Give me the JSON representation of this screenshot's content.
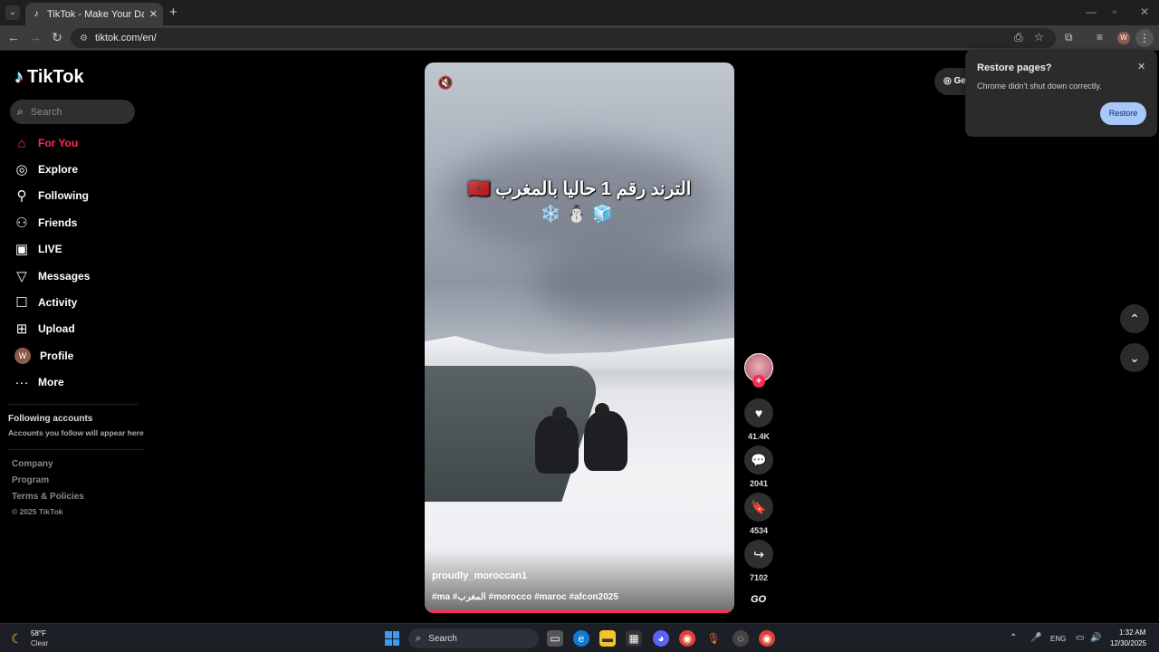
{
  "browser": {
    "tab_title": "TikTok - Make Your Day",
    "url": "tiktok.com/en/",
    "profile_initial": "W"
  },
  "sidebar": {
    "logo_text": "TikTok",
    "search_placeholder": "Search",
    "nav": [
      {
        "label": "For You",
        "icon": "home-icon",
        "active": true
      },
      {
        "label": "Explore",
        "icon": "compass-icon"
      },
      {
        "label": "Following",
        "icon": "user-follow-icon"
      },
      {
        "label": "Friends",
        "icon": "friends-icon"
      },
      {
        "label": "LIVE",
        "icon": "live-icon"
      },
      {
        "label": "Messages",
        "icon": "send-icon"
      },
      {
        "label": "Activity",
        "icon": "activity-icon"
      },
      {
        "label": "Upload",
        "icon": "upload-icon"
      },
      {
        "label": "Profile",
        "icon": "avatar",
        "initial": "W"
      },
      {
        "label": "More",
        "icon": "more-icon"
      }
    ],
    "following_accounts_title": "Following accounts",
    "following_accounts_sub": "Accounts you follow will appear here",
    "footer_links": [
      "Company",
      "Program",
      "Terms & Policies"
    ],
    "copyright": "© 2025 TikTok"
  },
  "video": {
    "overlay_text": "الترند رقم 1 حاليا بالمغرب 🇲🇦",
    "overlay_emoji": "❄️⛄🧊",
    "username": "proudly_moroccan1",
    "caption": "#ma #المغرب #morocco #maroc #afcon2025",
    "likes": "41.4K",
    "comments": "2041",
    "saves": "4534",
    "shares": "7102",
    "badge": "GO"
  },
  "get_app_label": "Ge",
  "restore_popup": {
    "title": "Restore pages?",
    "message": "Chrome didn't shut down correctly.",
    "button": "Restore"
  },
  "taskbar": {
    "temperature": "58°F",
    "condition": "Clear",
    "search_label": "Search",
    "lang": "ENG",
    "time": "1:32 AM",
    "date": "12/30/2025"
  },
  "colors": {
    "accent": "#fe2c55",
    "background": "#000000"
  }
}
